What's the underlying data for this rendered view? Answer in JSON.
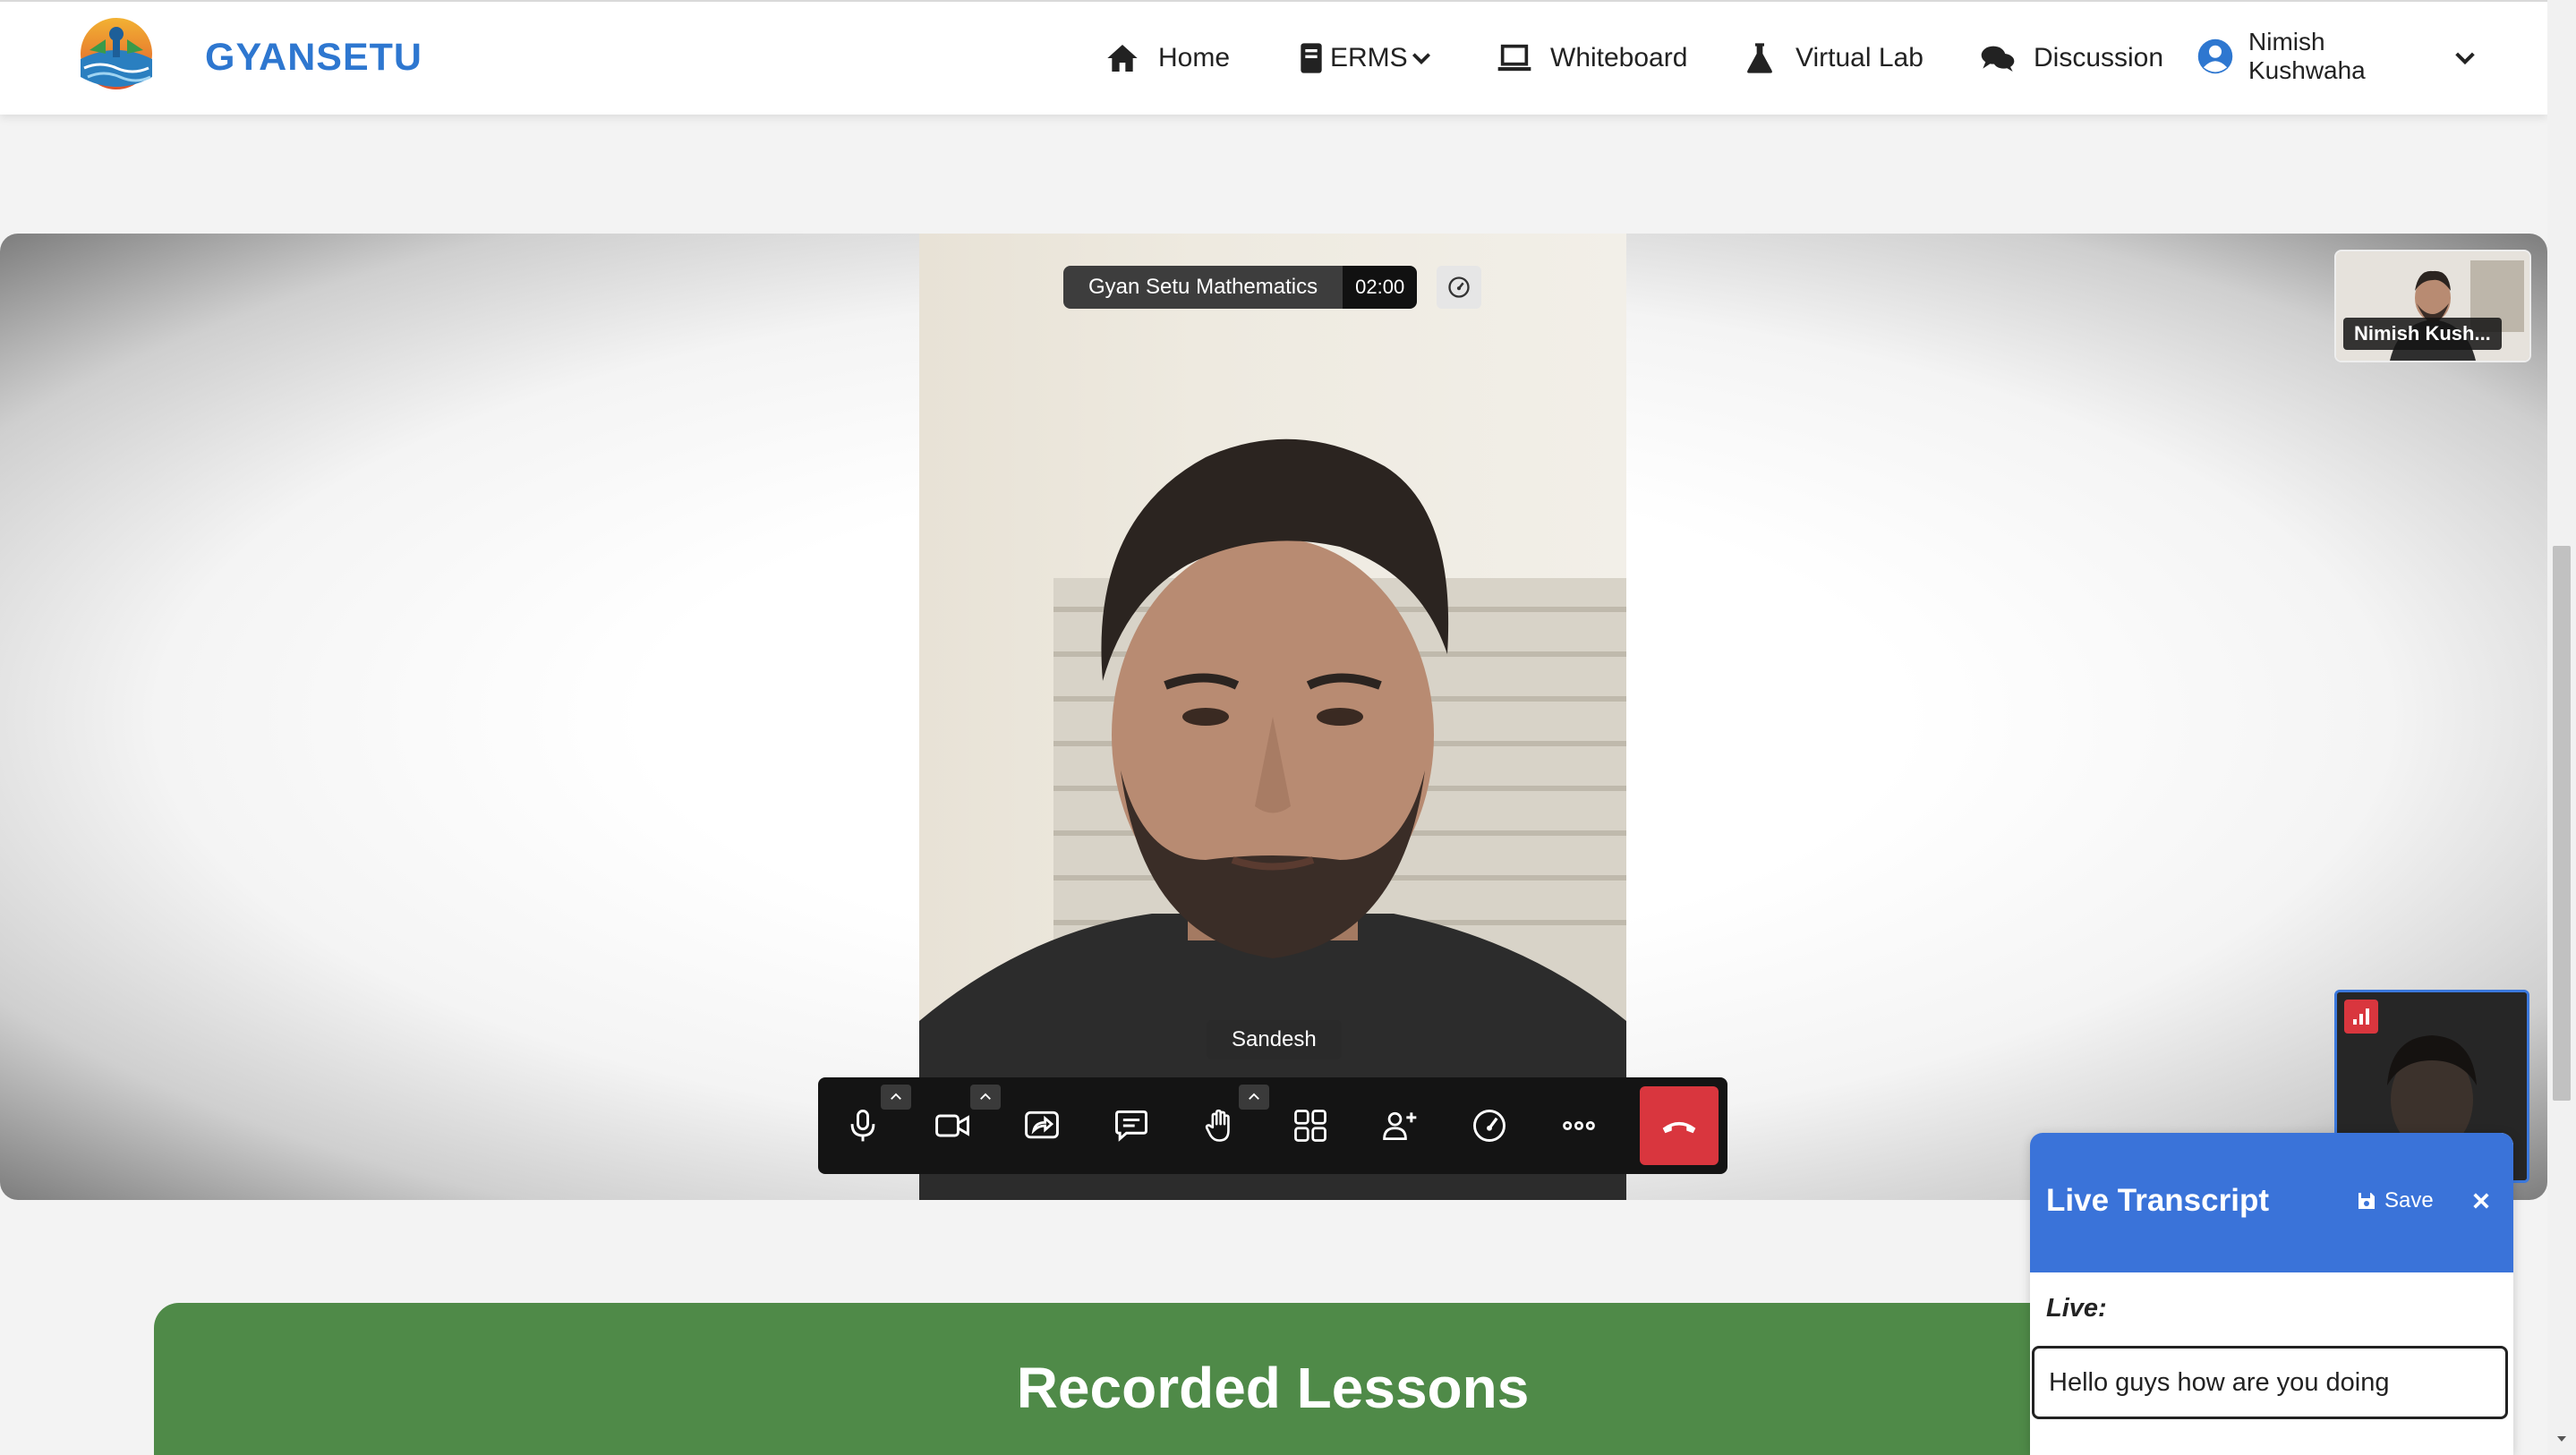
{
  "header": {
    "brand": "GYANSETU",
    "nav": [
      {
        "label": "Home",
        "icon": "home-icon"
      },
      {
        "label": "ERMS",
        "icon": "book-icon"
      },
      {
        "label": "Whiteboard",
        "icon": "laptop-icon"
      },
      {
        "label": "Virtual Lab",
        "icon": "flask-icon"
      },
      {
        "label": "Discussion",
        "icon": "comments-icon"
      }
    ],
    "user": {
      "first_name": "Nimish",
      "last_name": "Kushwaha",
      "icon": "user-circle-icon"
    }
  },
  "meeting": {
    "title": "Gyan Setu Mathematics",
    "timer": "02:00",
    "speaker_name": "Sandesh",
    "self_thumbnail_name": "Nimish Kush..."
  },
  "toolbar": {
    "buttons": [
      "microphone-icon",
      "camera-icon",
      "share-screen-icon",
      "chat-icon",
      "raise-hand-icon",
      "tile-view-icon",
      "invite-icon",
      "performance-icon",
      "more-icon",
      "hangup-icon"
    ]
  },
  "recorded": {
    "title": "Recorded Lessons"
  },
  "transcript": {
    "title": "Live Transcript",
    "save_label": "Save",
    "live_label": "Live:",
    "input_value": "Hello guys how are you doing"
  },
  "colors": {
    "brand_blue": "#2e77d0",
    "transcript_header": "#3a73d9",
    "recorded_green": "#4f8a48",
    "hangup_red": "#d9363e",
    "toolbar_bg": "#141414"
  }
}
